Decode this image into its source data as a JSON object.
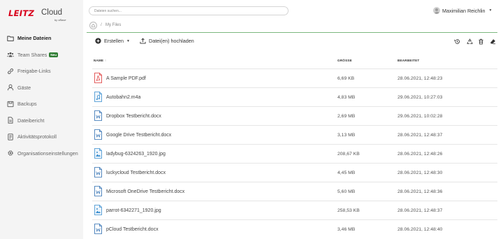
{
  "brand": {
    "logo": "LEITZ",
    "product": "Cloud",
    "sub": "by xBase"
  },
  "sidebar": {
    "items": [
      {
        "label": "Meine Dateien",
        "icon": "folder-icon",
        "active": true
      },
      {
        "label": "Team Shares",
        "icon": "team-icon",
        "badge": "Neu"
      },
      {
        "label": "Freigabe-Links",
        "icon": "link-icon"
      },
      {
        "label": "Gäste",
        "icon": "user-icon"
      },
      {
        "label": "Backups",
        "icon": "backup-icon"
      },
      {
        "label": "Dateibericht",
        "icon": "report-icon"
      },
      {
        "label": "Aktivitätsprotokoll",
        "icon": "activity-log-icon"
      },
      {
        "label": "Organisationseinstellungen",
        "icon": "gear-icon"
      }
    ]
  },
  "search": {
    "placeholder": "Dateien suchen..."
  },
  "user": {
    "name": "Maximilian Reichlin"
  },
  "breadcrumb": {
    "separator": "/",
    "current": "My Files"
  },
  "toolbar": {
    "create_label": "Erstellen",
    "upload_label": "Datei(en) hochladen"
  },
  "table": {
    "headers": {
      "name": "NAME",
      "name_sort": "↑",
      "size": "GRÖSSE",
      "modified": "BEARBEITET"
    },
    "rows": [
      {
        "name": "A Sample PDF.pdf",
        "size": "6,69 KB",
        "modified": "28.06.2021, 12:48:23",
        "type": "pdf"
      },
      {
        "name": "Autobahn2.m4a",
        "size": "4,83 MB",
        "modified": "29.06.2021, 10:27:03",
        "type": "audio"
      },
      {
        "name": "Dropbox Testbericht.docx",
        "size": "2,69 MB",
        "modified": "29.06.2021, 10:02:28",
        "type": "doc"
      },
      {
        "name": "Google Drive Testbericht.docx",
        "size": "3,13 MB",
        "modified": "28.06.2021, 12:48:37",
        "type": "doc"
      },
      {
        "name": "ladybug-6324263_1920.jpg",
        "size": "208,67 KB",
        "modified": "28.06.2021, 12:48:26",
        "type": "image"
      },
      {
        "name": "luckycloud Testbericht.docx",
        "size": "4,45 MB",
        "modified": "28.06.2021, 12:48:30",
        "type": "doc"
      },
      {
        "name": "Microsoft OneDrive Testbericht.docx",
        "size": "5,60 MB",
        "modified": "28.06.2021, 12:48:36",
        "type": "doc"
      },
      {
        "name": "parrot-6342271_1920.jpg",
        "size": "258,53 KB",
        "modified": "28.06.2021, 12:48:37",
        "type": "image"
      },
      {
        "name": "pCloud Testbericht.docx",
        "size": "3,46 MB",
        "modified": "28.06.2021, 12:48:40",
        "type": "doc"
      }
    ]
  },
  "colors": {
    "brand_red": "#d8001a",
    "sidebar_bg": "#f4f4f4",
    "accent_green": "#7cb87f",
    "badge_green": "#2e7d32"
  }
}
